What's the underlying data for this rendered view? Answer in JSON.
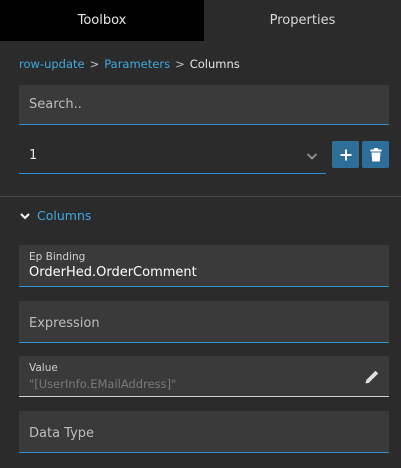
{
  "tabs": [
    {
      "label": "Toolbox",
      "active": true
    },
    {
      "label": "Properties",
      "active": false
    }
  ],
  "breadcrumb": {
    "items": [
      "row-update",
      "Parameters",
      "Columns"
    ],
    "separator": ">"
  },
  "search": {
    "placeholder": "Search.."
  },
  "selector": {
    "value": "1"
  },
  "toolbar": {
    "add_icon": "plus-icon",
    "delete_icon": "trash-icon"
  },
  "section": {
    "label": "Columns",
    "expanded": true
  },
  "fields": {
    "ep_binding": {
      "label": "Ep Binding",
      "value": "OrderHed.OrderComment"
    },
    "expression": {
      "placeholder": "Expression"
    },
    "value": {
      "label": "Value",
      "hint": "\"[UserInfo.EMailAddress]\"",
      "icon": "pencil-icon"
    },
    "data_type": {
      "placeholder": "Data Type"
    }
  },
  "colors": {
    "accent": "#3fa9e0",
    "button": "#2d6f99",
    "active_tab": "#000000",
    "panel": "#2b2b2b",
    "field": "#3a3a3a"
  }
}
